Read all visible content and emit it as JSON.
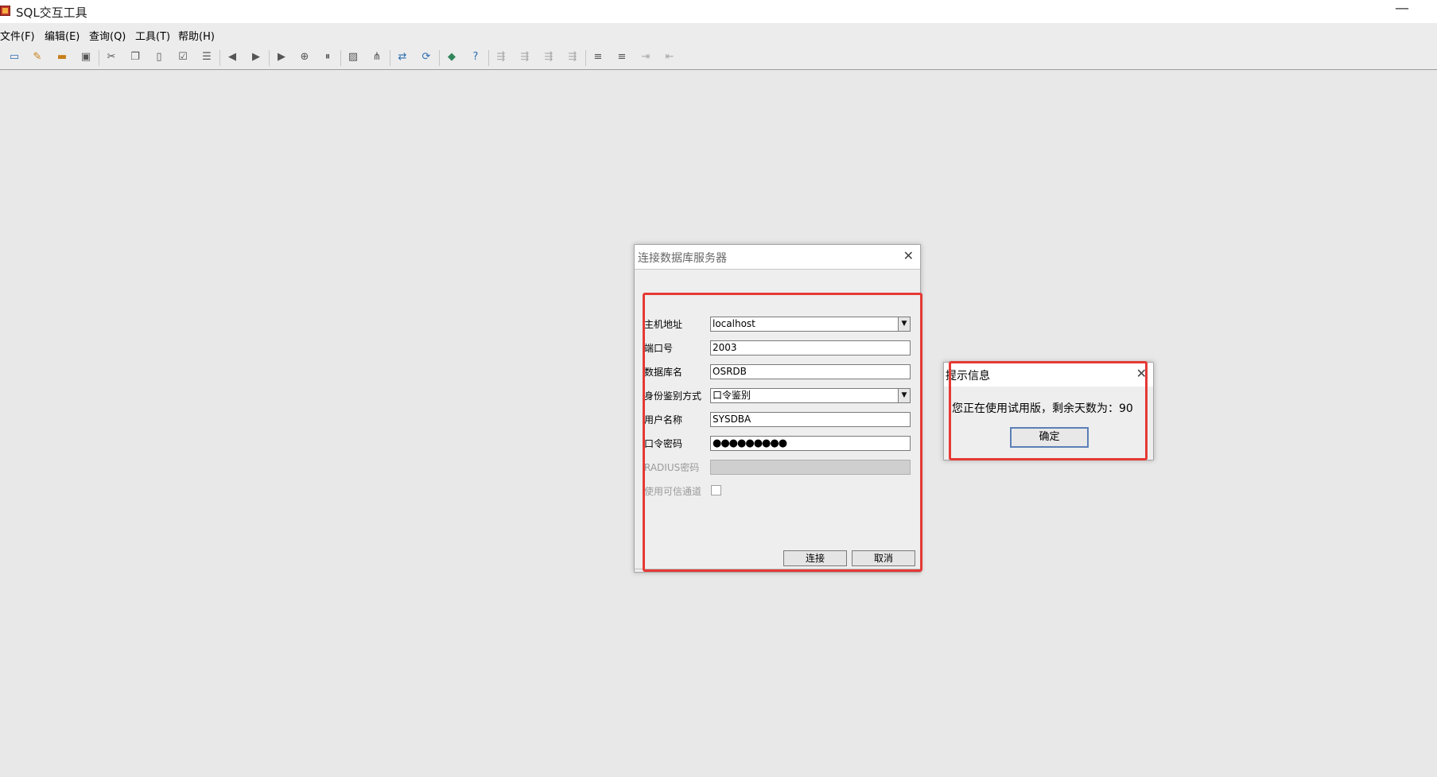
{
  "app": {
    "title": "SQL交互工具"
  },
  "menu": [
    "文件(F)",
    "编辑(E)",
    "查询(Q)",
    "工具(T)",
    "帮助(H)"
  ],
  "toolbar": [
    "monitor-icon",
    "edit-icon",
    "open-folder-icon",
    "save-icon",
    "cut-icon",
    "copy-icon",
    "paste-icon",
    "format-icon",
    "list-icon",
    "back-icon",
    "forward-icon",
    "run-icon",
    "step-icon",
    "stop-icon",
    "image-icon",
    "chart-icon",
    "swap-icon",
    "refresh-icon",
    "book-icon",
    "help-icon",
    "debug1-icon",
    "debug2-icon",
    "debug3-icon",
    "debug4-icon",
    "indent-icon",
    "outdent-icon",
    "comment-icon",
    "uncomment-icon"
  ],
  "connect_dialog": {
    "title": "连接数据库服务器",
    "host_label": "主机地址",
    "host_value": "localhost",
    "port_label": "端口号",
    "port_value": "2003",
    "db_label": "数据库名",
    "db_value": "OSRDB",
    "auth_label": "身份鉴别方式",
    "auth_value": "口令鉴别",
    "user_label": "用户名称",
    "user_value": "SYSDBA",
    "password_label": "口令密码",
    "password_value": "●●●●●●●●●",
    "radius_label": "RADIUS密码",
    "trusted_label": "使用可信通道",
    "connect_button": "连接",
    "cancel_button": "取消"
  },
  "info_dialog": {
    "title": "提示信息",
    "message": "您正在使用试用版，剩余天数为：90",
    "ok_button": "确定"
  },
  "colors": {
    "highlight": "#e53935",
    "ok_border": "#5b7fb7"
  }
}
